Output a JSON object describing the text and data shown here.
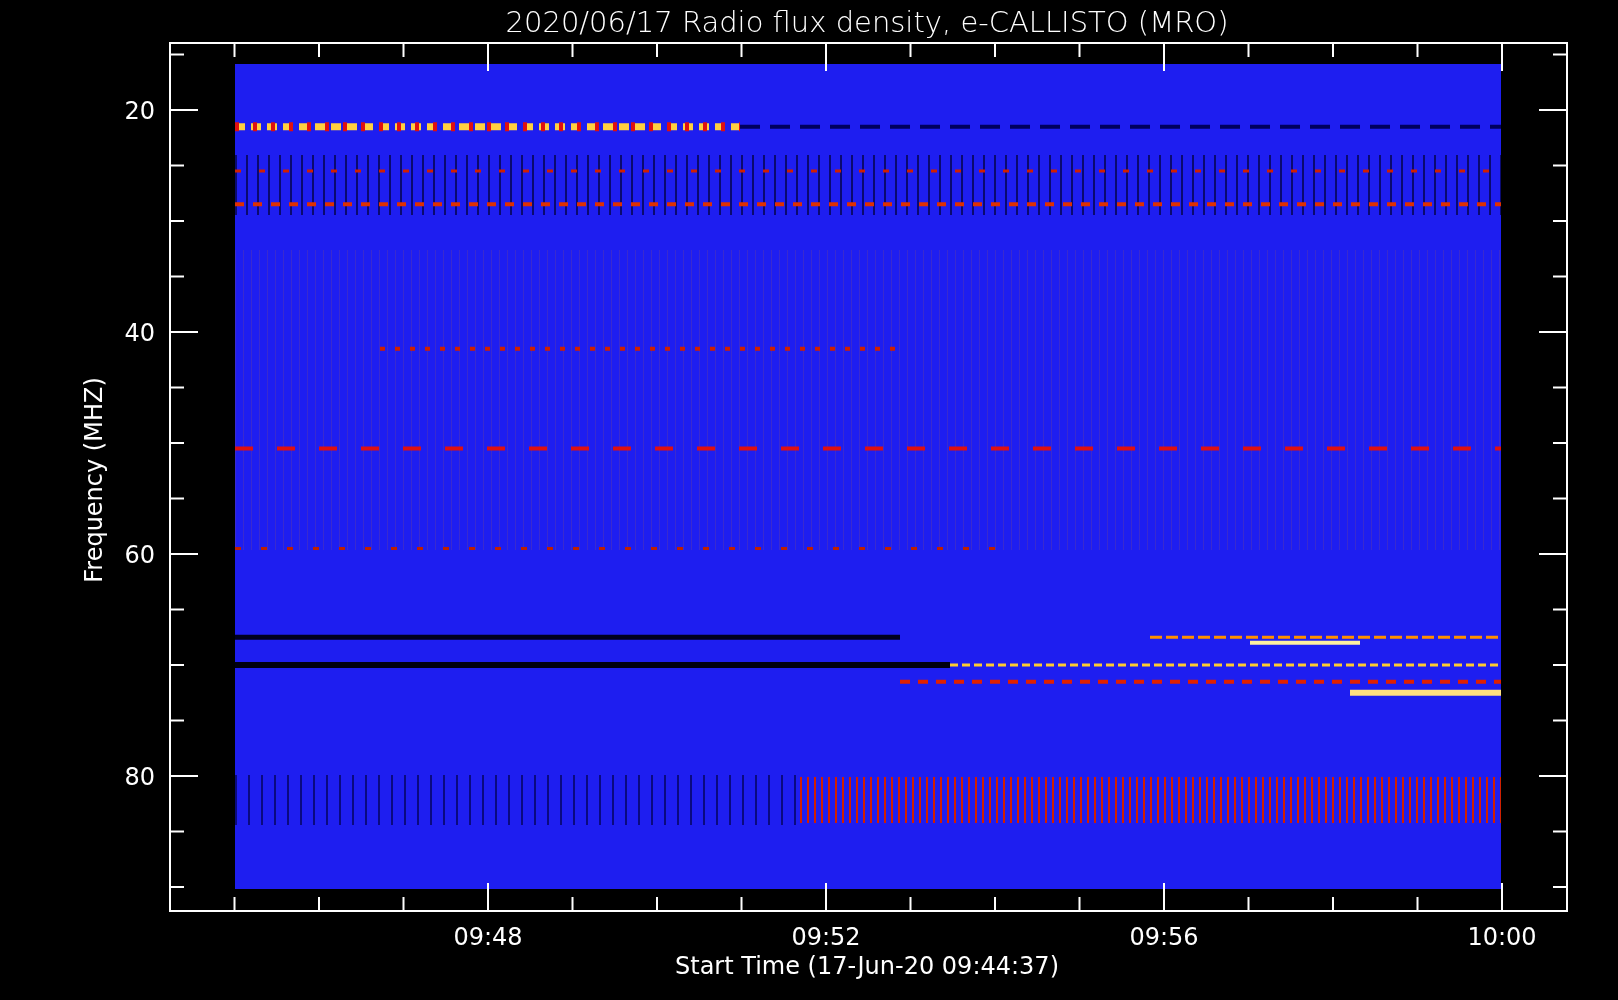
{
  "title": "2020/06/17  Radio flux density, e-CALLISTO (MRO)",
  "y_axis": {
    "label": "Frequency (MHZ)",
    "tick_labels": [
      "20",
      "40",
      "60",
      "80"
    ]
  },
  "x_axis": {
    "label": "Start Time (17-Jun-20 09:44:37)",
    "tick_labels": [
      "09:48",
      "09:52",
      "09:56",
      "10:00"
    ]
  }
}
